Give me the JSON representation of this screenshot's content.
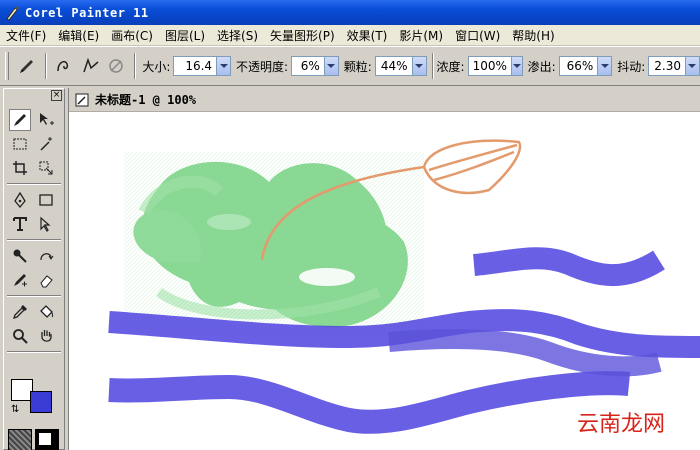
{
  "window": {
    "title": "Corel Painter 11"
  },
  "menu": [
    "文件(F)",
    "编辑(E)",
    "画布(C)",
    "图层(L)",
    "选择(S)",
    "矢量图形(P)",
    "效果(T)",
    "影片(M)",
    "窗口(W)",
    "帮助(H)"
  ],
  "properties": {
    "size": {
      "label": "大小:",
      "value": "16.4"
    },
    "opacity": {
      "label": "不透明度:",
      "value": "6%"
    },
    "grain": {
      "label": "颗粒:",
      "value": "44%"
    },
    "concentration": {
      "label": "浓度:",
      "value": "100%"
    },
    "bleed": {
      "label": "渗出:",
      "value": "66%"
    },
    "jitter": {
      "label": "抖动:",
      "value": "2.30"
    }
  },
  "toolbox": {
    "close": "×",
    "colors": {
      "main": "#ffffff",
      "additional": "#3b3bd6"
    }
  },
  "document": {
    "title": "未标题-1 @ 100%"
  },
  "canvas": {
    "colors": {
      "green": "#7ed58a",
      "orange": "#e39a6c",
      "blue": "#4f44e0"
    }
  },
  "watermark": "云南龙网"
}
